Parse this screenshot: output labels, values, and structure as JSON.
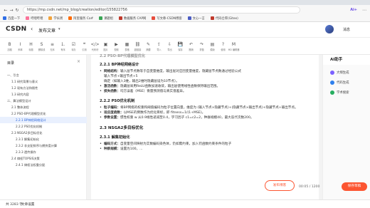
{
  "browser": {
    "url": "https://mp.csdn.net/mp_blog/creation/editor/155822756",
    "ai_label": "Ai+",
    "bookmarks": [
      {
        "label": "百度一下",
        "color": "#2f6ee6"
      },
      {
        "label": "哔哩哔哩",
        "color": "#fb7299"
      },
      {
        "label": "学长周",
        "color": "#f2a33b"
      },
      {
        "label": "阿里服务 Ca#",
        "color": "#ff6a00"
      },
      {
        "label": "课题组",
        "color": "#3aa655"
      },
      {
        "label": "数据服务 CAP网",
        "color": "#c0392b"
      },
      {
        "label": "写文章-CSDN博客",
        "color": "#e74c3c"
      },
      {
        "label": "文心一言",
        "color": "#4b5cc4"
      },
      {
        "label": "代码仓库(Gitee)",
        "color": "#c0392b"
      }
    ]
  },
  "header": {
    "logo": "CSDN",
    "back_icon": "‹",
    "title": "发布文章",
    "message": "消息"
  },
  "toolbar": {
    "tools": [
      "加粗",
      "斜体",
      "标题",
      "删除线",
      "无序",
      "有序",
      "待办",
      "引用",
      "代码块",
      "图片",
      "视频",
      "表格",
      "超链接",
      "摘要",
      "导入",
      "导出",
      "保存",
      "撤销",
      "重做",
      "模版",
      "使用",
      "MD 编辑器"
    ]
  },
  "toc": {
    "title": "目录",
    "close": "×",
    "items": [
      {
        "label": "一、引言",
        "indent": 1,
        "active": false
      },
      {
        "label": "1.1 研究背景与意义",
        "indent": 2,
        "active": false
      },
      {
        "label": "1.2 现有方法和限性",
        "indent": 2,
        "active": false
      },
      {
        "label": "1.3 研究内容",
        "indent": 2,
        "active": false
      },
      {
        "label": "二、算法模型设计",
        "indent": 1,
        "active": false
      },
      {
        "label": "2.1 整体流程",
        "indent": 2,
        "active": false
      },
      {
        "label": "2.2 PSO-BP代理模型优化",
        "indent": 2,
        "active": false
      },
      {
        "label": "2.2.1 BP神经网络设计",
        "indent": 3,
        "active": true
      },
      {
        "label": "2.2.2 PSO优化机制",
        "indent": 3,
        "active": false
      },
      {
        "label": "2.3 NSGA2多目标优化",
        "indent": 2,
        "active": false
      },
      {
        "label": "2.3.1 解集初始化",
        "indent": 3,
        "active": false
      },
      {
        "label": "2.3.2 非支配排序与拥挤度计算",
        "indent": 3,
        "active": false
      },
      {
        "label": "2.3.3 遗传操作",
        "indent": 3,
        "active": false
      },
      {
        "label": "2.4 熵权TOPSIS决策",
        "indent": 2,
        "active": false
      },
      {
        "label": "2.4.1 熵权法权重分配",
        "indent": 3,
        "active": false
      }
    ]
  },
  "editor": {
    "top_heading": "2.2 PSO-BP代理模型优化",
    "h221": "2.2.1 BP神经网络设计",
    "b1_label": "网络结构：",
    "b1_text": "输入层节点数等于自变量维度，输出层对应因变量维度，隐藏层节点数通过经验公式",
    "b1_line2": "输入节点+输出节点+5",
    "b1_line3": "确定（如输入3维，输出2维时隐藏层设为10节点）。",
    "b2_label": "激活函数：",
    "b2_text": "隐藏层采用ReLU函数加速收敛，输出层使用线性函数保持输出范围。",
    "b3_label": "损失函数：",
    "b3_text": "均方误差（MSE）衡量预测值与真实值差异。",
    "h222": "2.2.2 PSO优化机制",
    "b4_label": "粒子编码：",
    "b4_text": "将BP网络的权重和阈值编码为粒子位置向量，维度为 (输入节点×隐藏节点)+(隐藏节点×输出节点)+隐藏节点+输出节点。",
    "b5_label": "适应度函数：",
    "b5_text": "以MSE的倒数作为优化目标，即 fitness=1/(1+MSE)。",
    "b6_label": "参数设置：",
    "b6_text": "惯性权重 w 从0.9线性递减至0.4，学习因子 c1=c2=2，种群规模40，最大迭代次数200。",
    "h23": "2.3 NSGA2多目标优化",
    "h231": "2.3.1 解集初始化",
    "b7_label": "编码方式：",
    "b7_text": "自变量空间映射为实数编码染色体，仍如需约束，加入罚函数约束条件的粒子",
    "b8_label": "种群规模：",
    "b8_text": "设置为100，..."
  },
  "right_panel": {
    "title": "AI助手",
    "items": [
      {
        "label": "大纲生成",
        "color": "#7b61ff"
      },
      {
        "label": "代码生成",
        "color": "#2f80ed"
      },
      {
        "label": "学术搜索",
        "color": "#27ae60"
      }
    ]
  },
  "footer": {
    "word_count": "共 3283 字",
    "settings": "文章设置",
    "publish": "发布博客",
    "hint": "00:05 / 1200",
    "save": "保存草稿"
  }
}
